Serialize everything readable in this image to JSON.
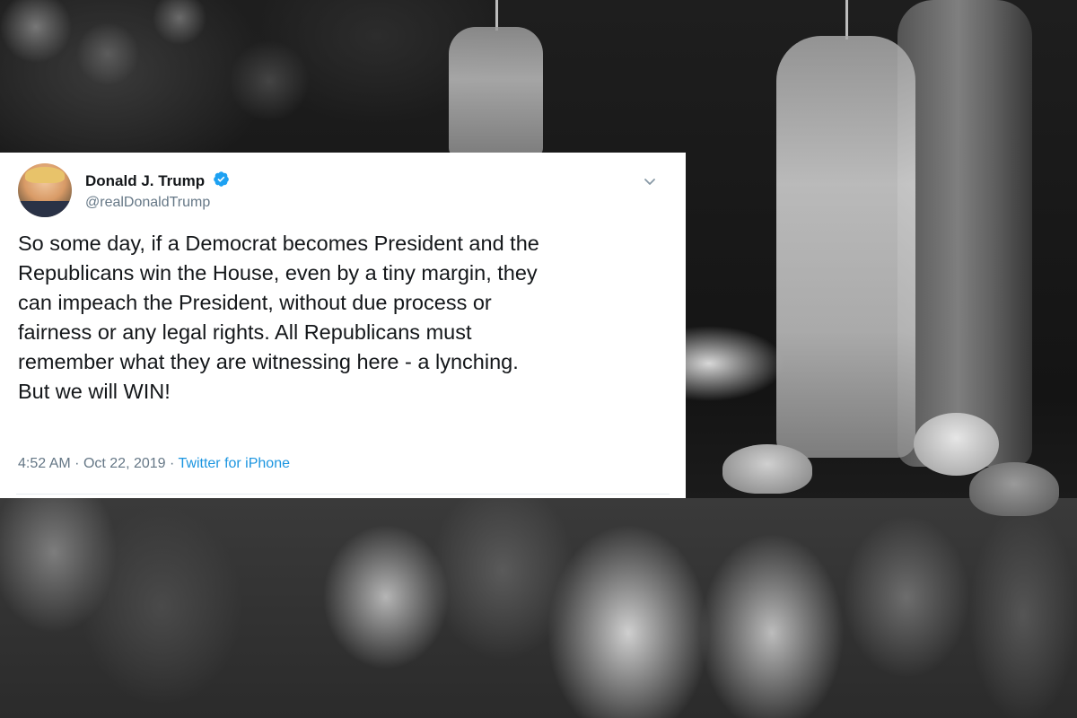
{
  "tweet": {
    "display_name": "Donald J. Trump",
    "handle": "@realDonaldTrump",
    "verified": true,
    "text": "So some day, if a Democrat becomes President and the\nRepublicans win the House, even by a tiny margin, they\ncan impeach the President, without due process or\nfairness or any legal rights. All Republicans must\nremember what they are witnessing here - a lynching.\nBut we will WIN!",
    "time": "4:52 AM",
    "separator": "·",
    "date": "Oct 22, 2019",
    "source": "Twitter for iPhone",
    "icons": {
      "avatar": "profile-photo",
      "verified": "verified-badge-icon",
      "menu": "chevron-down-icon"
    },
    "colors": {
      "verified_blue": "#1da1f2",
      "link_blue": "#1b95e0",
      "secondary_text": "#657786",
      "primary_text": "#14171a"
    }
  }
}
